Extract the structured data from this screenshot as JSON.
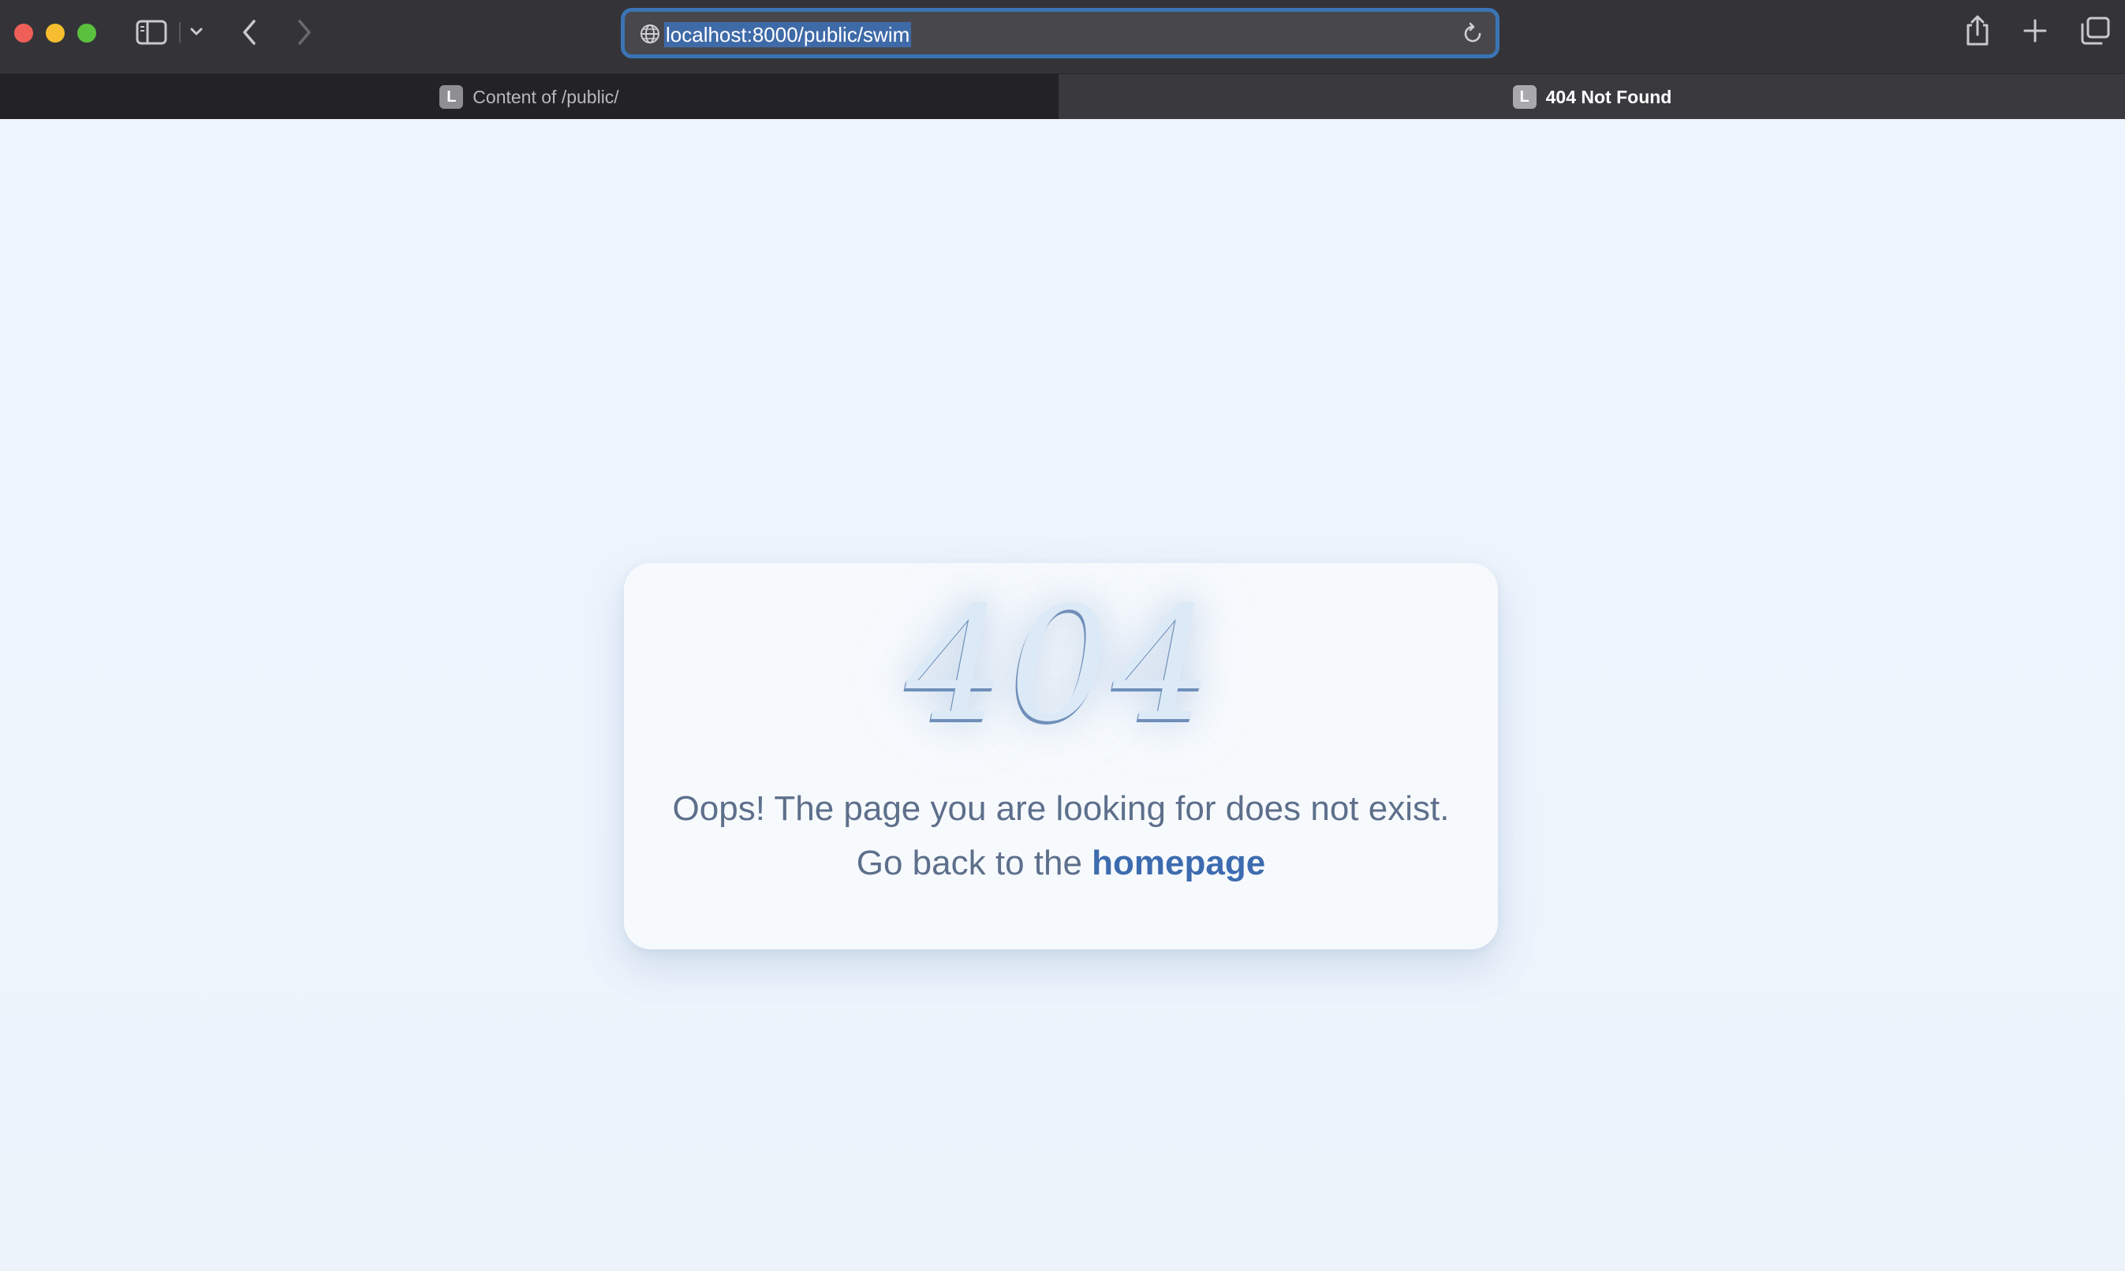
{
  "browser": {
    "address_bar": {
      "url": "localhost:8000/public/swim"
    },
    "tabs": [
      {
        "favicon_letter": "L",
        "title": "Content of /public/",
        "active": false
      },
      {
        "favicon_letter": "L",
        "title": "404 Not Found",
        "active": true
      }
    ],
    "icons": {
      "close": "close-window-icon",
      "minimize": "minimize-window-icon",
      "maximize": "maximize-window-icon",
      "sidebar": "sidebar-icon",
      "sidebar_menu": "chevron-down-icon",
      "back": "chevron-left-icon",
      "forward": "chevron-right-icon",
      "globe": "globe-icon",
      "reload": "reload-icon",
      "share": "share-icon",
      "new_tab": "plus-icon",
      "tab_overview": "tab-overview-icon"
    }
  },
  "error_page": {
    "code": "404",
    "message": "Oops! The page you are looking for does not exist.",
    "back_prefix": "Go back to the",
    "back_link": "homepage"
  },
  "colors": {
    "page_background": "#eef5fd",
    "card_background": "#f7fafd",
    "text": "#5d6f8b",
    "link": "#3d6bb0",
    "address_focus": "#3b74b5"
  }
}
